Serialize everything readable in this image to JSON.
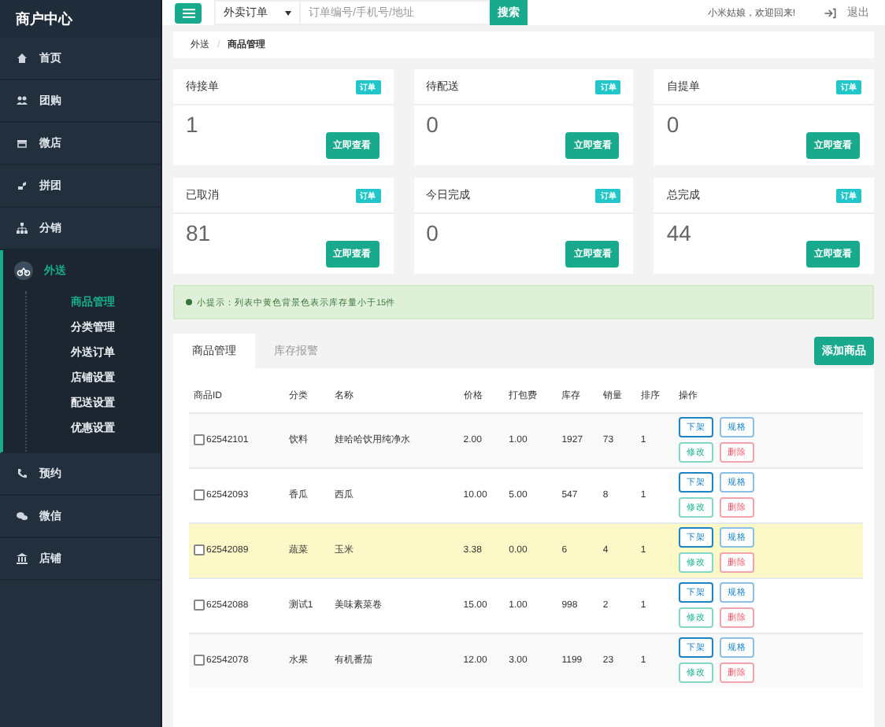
{
  "sidebar": {
    "title": "商户中心",
    "items": [
      {
        "label": "首页",
        "selected": false
      },
      {
        "label": "团购",
        "selected": false
      },
      {
        "label": "微店",
        "selected": false
      },
      {
        "label": "拼团",
        "selected": false
      },
      {
        "label": "分销",
        "selected": false
      },
      {
        "label": "外送",
        "selected": true,
        "children": [
          {
            "label": "商品管理",
            "selected": true
          },
          {
            "label": "分类管理",
            "selected": false
          },
          {
            "label": "外送订单",
            "selected": false
          },
          {
            "label": "店铺设置",
            "selected": false
          },
          {
            "label": "配送设置",
            "selected": false
          },
          {
            "label": "优惠设置",
            "selected": false
          }
        ]
      },
      {
        "label": "预约",
        "selected": false
      },
      {
        "label": "微信",
        "selected": false
      },
      {
        "label": "店铺",
        "selected": false
      }
    ]
  },
  "topbar": {
    "search_type": "外卖订单",
    "placeholder": "订单编号/手机号/地址",
    "search_button": "搜索",
    "welcome": "小米姑娘，欢迎回来!",
    "logout": "退出"
  },
  "breadcrumb": {
    "separator": "/",
    "items": [
      "外送",
      "商品管理"
    ]
  },
  "stat_cards": [
    {
      "title": "待接单",
      "badge": "订单",
      "value": "1",
      "button": "立即查看"
    },
    {
      "title": "待配送",
      "badge": "订单",
      "value": "0",
      "button": "立即查看"
    },
    {
      "title": "自提单",
      "badge": "订单",
      "value": "0",
      "button": "立即查看"
    },
    {
      "title": "已取消",
      "badge": "订单",
      "value": "81",
      "button": "立即查看"
    },
    {
      "title": "今日完成",
      "badge": "订单",
      "value": "0",
      "button": "立即查看"
    },
    {
      "title": "总完成",
      "badge": "订单",
      "value": "44",
      "button": "立即查看"
    }
  ],
  "tip": "小提示：列表中黄色背景色表示库存量小于15件",
  "tabs": [
    {
      "label": "商品管理",
      "selected": true
    },
    {
      "label": "库存报警",
      "selected": false
    }
  ],
  "add_button": "添加商品",
  "table": {
    "columns": [
      "商品ID",
      "分类",
      "名称",
      "价格",
      "打包费",
      "库存",
      "销量",
      "排序",
      "操作"
    ],
    "rows": [
      {
        "id": "62542101",
        "category": "饮料",
        "name": "娃哈哈饮用纯净水",
        "price": "2.00",
        "packing": "1.00",
        "stock": "1927",
        "sales": "73",
        "order": "1",
        "checked": false,
        "low_stock": false,
        "actions": [
          "下架",
          "规格",
          "修改",
          "删除"
        ]
      },
      {
        "id": "62542093",
        "category": "香瓜",
        "name": "西瓜",
        "price": "10.00",
        "packing": "5.00",
        "stock": "547",
        "sales": "8",
        "order": "1",
        "checked": false,
        "low_stock": false,
        "actions": [
          "下架",
          "规格",
          "修改",
          "删除"
        ]
      },
      {
        "id": "62542089",
        "category": "蔬菜",
        "name": "玉米",
        "price": "3.38",
        "packing": "0.00",
        "stock": "6",
        "sales": "4",
        "order": "1",
        "checked": false,
        "low_stock": true,
        "actions": [
          "下架",
          "规格",
          "修改",
          "删除"
        ]
      },
      {
        "id": "62542088",
        "category": "测试1",
        "name": "美味素菜卷",
        "price": "15.00",
        "packing": "1.00",
        "stock": "998",
        "sales": "2",
        "order": "1",
        "checked": false,
        "low_stock": false,
        "actions": [
          "下架",
          "规格",
          "修改",
          "删除"
        ]
      },
      {
        "id": "62542078",
        "category": "水果",
        "name": "有机番茄",
        "price": "12.00",
        "packing": "3.00",
        "stock": "1199",
        "sales": "23",
        "order": "1",
        "checked": false,
        "low_stock": false,
        "actions": [
          "下架",
          "规格",
          "修改",
          "删除"
        ]
      }
    ]
  }
}
